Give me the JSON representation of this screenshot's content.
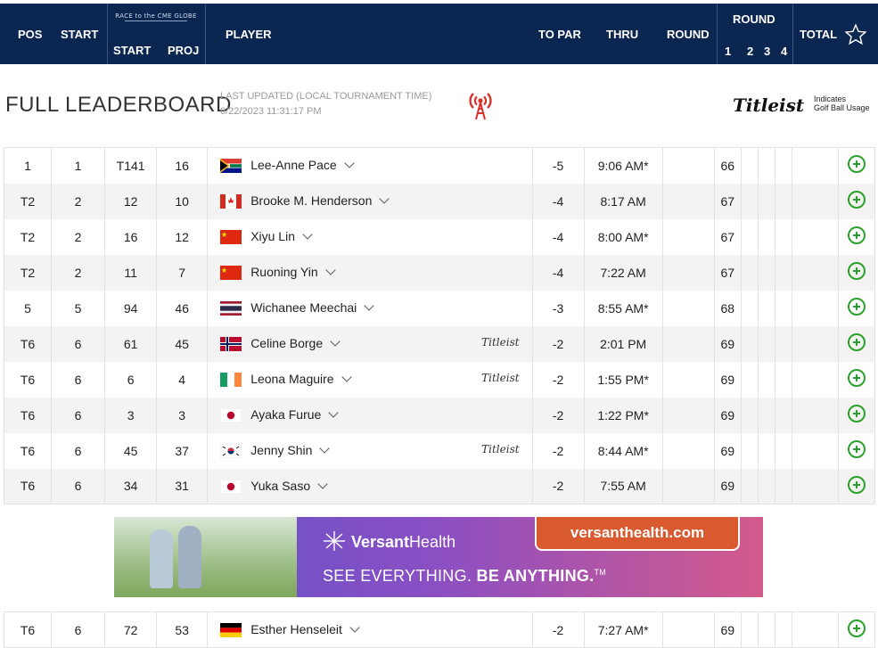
{
  "header": {
    "pos": "POS",
    "start": "START",
    "race": "RACE to the CME GLOBE",
    "race_start": "START",
    "race_proj": "PROJ",
    "player": "PLAYER",
    "to_par": "TO PAR",
    "thru": "THRU",
    "round": "ROUND",
    "round_group": "ROUND",
    "round_nums": [
      "1",
      "2",
      "3",
      "4"
    ],
    "total": "TOTAL"
  },
  "title": {
    "main": "FULL LEADERBOARD",
    "updated_label": "LAST UPDATED (LOCAL TOURNAMENT TIME)",
    "updated_value": "6/22/2023 11:31:17 PM",
    "titleist_logo": "Titleist",
    "indicates": "Indicates",
    "golf_ball_usage": "Golf Ball Usage"
  },
  "rows": [
    {
      "pos": "1",
      "start": "1",
      "cme_start": "T141",
      "cme_proj": "16",
      "flag": "ZA",
      "player": "Lee-Anne Pace",
      "titleist": "",
      "to_par": "-5",
      "thru": "9:06 AM*",
      "round": "",
      "r1": "66"
    },
    {
      "pos": "T2",
      "start": "2",
      "cme_start": "12",
      "cme_proj": "10",
      "flag": "CA",
      "player": "Brooke M. Henderson",
      "titleist": "",
      "to_par": "-4",
      "thru": "8:17 AM",
      "round": "",
      "r1": "67"
    },
    {
      "pos": "T2",
      "start": "2",
      "cme_start": "16",
      "cme_proj": "12",
      "flag": "CN",
      "player": "Xiyu Lin",
      "titleist": "",
      "to_par": "-4",
      "thru": "8:00 AM*",
      "round": "",
      "r1": "67"
    },
    {
      "pos": "T2",
      "start": "2",
      "cme_start": "11",
      "cme_proj": "7",
      "flag": "CN",
      "player": "Ruoning Yin",
      "titleist": "",
      "to_par": "-4",
      "thru": "7:22 AM",
      "round": "",
      "r1": "67"
    },
    {
      "pos": "5",
      "start": "5",
      "cme_start": "94",
      "cme_proj": "46",
      "flag": "TH",
      "player": "Wichanee Meechai",
      "titleist": "",
      "to_par": "-3",
      "thru": "8:55 AM*",
      "round": "",
      "r1": "68"
    },
    {
      "pos": "T6",
      "start": "6",
      "cme_start": "61",
      "cme_proj": "45",
      "flag": "NO",
      "player": "Celine Borge",
      "titleist": "Titleist",
      "to_par": "-2",
      "thru": "2:01 PM",
      "round": "",
      "r1": "69"
    },
    {
      "pos": "T6",
      "start": "6",
      "cme_start": "6",
      "cme_proj": "4",
      "flag": "IE",
      "player": "Leona Maguire",
      "titleist": "Titleist",
      "to_par": "-2",
      "thru": "1:55 PM*",
      "round": "",
      "r1": "69"
    },
    {
      "pos": "T6",
      "start": "6",
      "cme_start": "3",
      "cme_proj": "3",
      "flag": "JP",
      "player": "Ayaka Furue",
      "titleist": "",
      "to_par": "-2",
      "thru": "1:22 PM*",
      "round": "",
      "r1": "69"
    },
    {
      "pos": "T6",
      "start": "6",
      "cme_start": "45",
      "cme_proj": "37",
      "flag": "KR",
      "player": "Jenny Shin",
      "titleist": "Titleist",
      "to_par": "-2",
      "thru": "8:44 AM*",
      "round": "",
      "r1": "69"
    },
    {
      "pos": "T6",
      "start": "6",
      "cme_start": "34",
      "cme_proj": "31",
      "flag": "JP",
      "player": "Yuka Saso",
      "titleist": "",
      "to_par": "-2",
      "thru": "7:55 AM",
      "round": "",
      "r1": "69"
    }
  ],
  "rows_after_ad": [
    {
      "pos": "T6",
      "start": "6",
      "cme_start": "72",
      "cme_proj": "53",
      "flag": "DE",
      "player": "Esther Henseleit",
      "titleist": "",
      "to_par": "-2",
      "thru": "7:27 AM*",
      "round": "",
      "r1": "69"
    }
  ],
  "ad": {
    "brand_a": "Versant",
    "brand_b": "Health",
    "url": "versanthealth.com",
    "tagline_a": "SEE EVERYTHING.",
    "tagline_b": "BE ANYTHING.",
    "tm": "TM"
  },
  "colors": {
    "header_bg": "#0c2652",
    "plus": "#2aa22a",
    "tower": "#d9302a",
    "ad_button": "#d85a2e"
  }
}
